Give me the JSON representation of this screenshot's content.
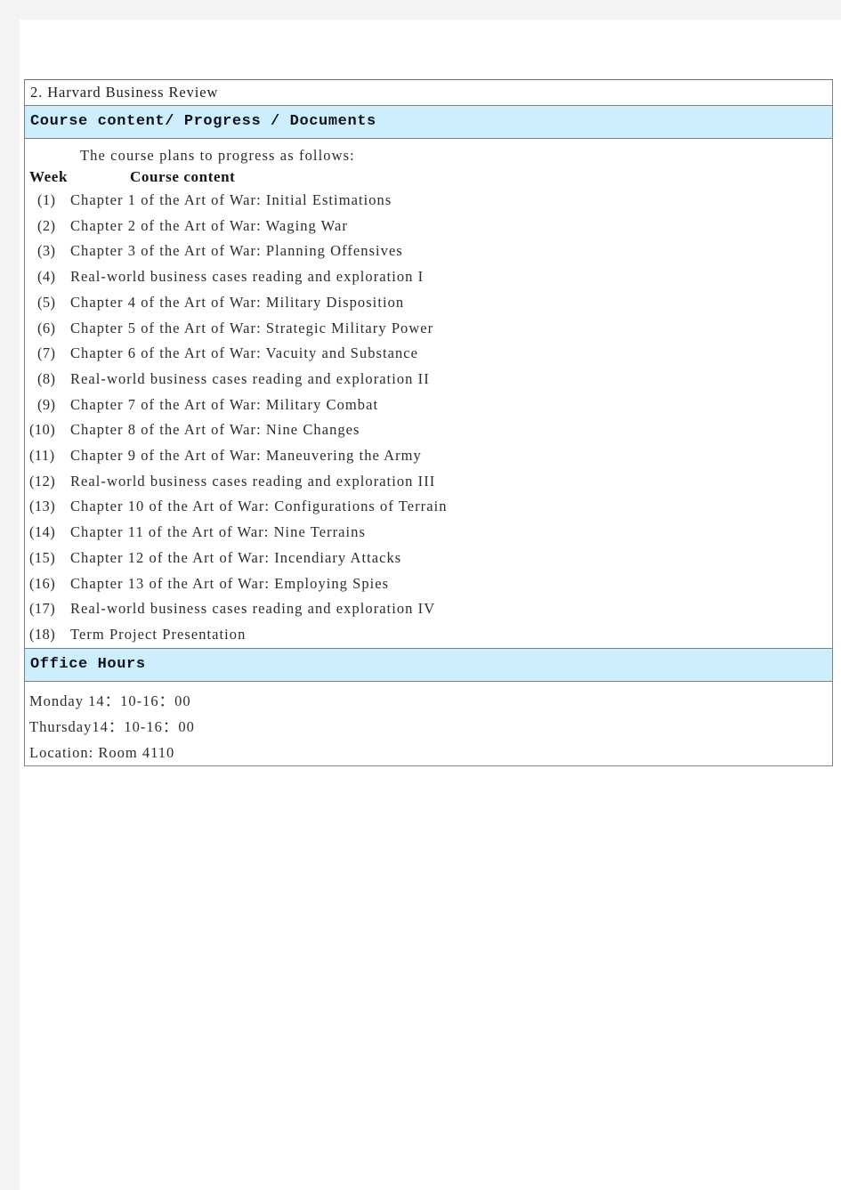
{
  "document": {
    "item_number_title": "2.  Harvard Business Review",
    "section_heading": "Course content/ Progress / Documents",
    "intro_line": "The course plans to progress as follows:",
    "columns": {
      "week": "Week",
      "course_content": "Course content"
    },
    "weeks": [
      {
        "num": "(1)",
        "content": "Chapter 1 of the Art of War: Initial Estimations"
      },
      {
        "num": "(2)",
        "content": "Chapter 2 of the Art of War: Waging War"
      },
      {
        "num": "(3)",
        "content": "Chapter 3 of the Art of War: Planning Offensives"
      },
      {
        "num": "(4)",
        "content": "Real-world business cases reading and exploration I"
      },
      {
        "num": "(5)",
        "content": "Chapter 4 of the Art of War: Military Disposition"
      },
      {
        "num": "(6)",
        "content": "Chapter 5 of the Art of War: Strategic Military Power"
      },
      {
        "num": "(7)",
        "content": "Chapter 6 of the Art of War: Vacuity and Substance"
      },
      {
        "num": "(8)",
        "content": "Real-world business cases reading and exploration II"
      },
      {
        "num": "(9)",
        "content": "Chapter 7 of the Art of War: Military Combat"
      },
      {
        "num": "(10)",
        "content": "Chapter 8 of the Art of War: Nine Changes"
      },
      {
        "num": "(11)",
        "content": "Chapter 9 of the Art of War: Maneuvering the Army"
      },
      {
        "num": "(12)",
        "content": "Real-world business cases reading and exploration III"
      },
      {
        "num": "(13)",
        "content": "Chapter 10 of the Art of War: Configurations of Terrain"
      },
      {
        "num": "(14)",
        "content": "Chapter 11 of the Art of War: Nine Terrains"
      },
      {
        "num": "(15)",
        "content": "Chapter 12 of the Art of War: Incendiary Attacks"
      },
      {
        "num": "(16)",
        "content": "Chapter 13 of the Art of War: Employing Spies"
      },
      {
        "num": "(17)",
        "content": "Real-world business cases reading and exploration IV"
      },
      {
        "num": "(18)",
        "content": "Term Project Presentation"
      }
    ],
    "office_hours": {
      "heading": "Office Hours",
      "lines": [
        "Monday 14：10-16：00",
        "Thursday14：10-16：00",
        "Location: Room 4110"
      ]
    }
  },
  "colors": {
    "band_background": "#cdeffd",
    "page_background": "#ffffff",
    "canvas_background": "#f4f4f4",
    "border": "#808080",
    "text": "#2b2b33"
  }
}
